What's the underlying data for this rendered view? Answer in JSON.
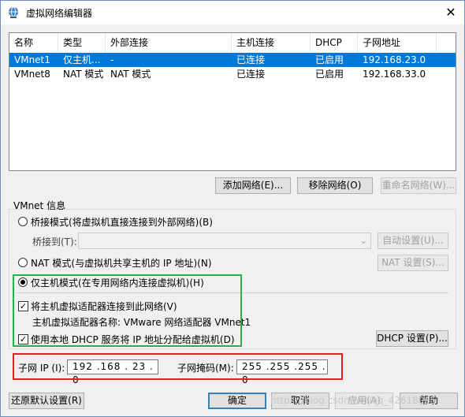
{
  "window": {
    "title": "虚拟网络编辑器",
    "close_glyph": "✕"
  },
  "table": {
    "headers": [
      "名称",
      "类型",
      "外部连接",
      "主机连接",
      "DHCP",
      "子网地址"
    ],
    "rows": [
      {
        "name": "VMnet1",
        "type": "仅主机...",
        "external": "-",
        "host": "已连接",
        "dhcp": "已启用",
        "subnet": "192.168.23.0",
        "selected": true
      },
      {
        "name": "VMnet8",
        "type": "NAT 模式",
        "external": "NAT 模式",
        "host": "已连接",
        "dhcp": "已启用",
        "subnet": "192.168.33.0",
        "selected": false
      }
    ]
  },
  "network_buttons": {
    "add": "添加网络(E)...",
    "remove": "移除网络(O)",
    "rename": "重命名网络(W)..."
  },
  "vmnet_info": {
    "label": "VMnet 信息",
    "bridged": {
      "label": "桥接模式(将虚拟机直接连接到外部网络)(B)",
      "bridge_to_label": "桥接到(T):",
      "bridge_to_value": "",
      "auto_button": "自动设置(U)..."
    },
    "nat": {
      "label": "NAT 模式(与虚拟机共享主机的 IP 地址)(N)",
      "settings_button": "NAT 设置(S)..."
    },
    "host_only": {
      "label": "仅主机模式(在专用网络内连接虚拟机)(H)",
      "selected": true
    },
    "connect_adapter": {
      "label": "将主机虚拟适配器连接到此网络(V)",
      "checked": true,
      "check_glyph": "✓"
    },
    "adapter_name": "主机虚拟适配器名称: VMware 网络适配器 VMnet1",
    "use_dhcp": {
      "label": "使用本地 DHCP 服务将 IP 地址分配给虚拟机(D)",
      "checked": true,
      "check_glyph": "✓",
      "settings_button": "DHCP 设置(P)..."
    },
    "subnet_ip": {
      "label": "子网 IP (I):",
      "value": "192 .168 . 23 . 0"
    },
    "subnet_mask": {
      "label": "子网掩码(M):",
      "value": "255 .255 .255 . 0"
    }
  },
  "footer": {
    "restore": "还原默认设置(R)",
    "ok": "确定",
    "cancel": "取消",
    "apply": "应用(A)",
    "help": "帮助"
  },
  "watermark": "https://blog.csdn.net/qq_42618065",
  "colors": {
    "selection": "#0078d7",
    "green_highlight": "#22b14c",
    "red_highlight": "#ed1c24"
  },
  "icons": {
    "app": "network-globe-icon",
    "close": "close-icon",
    "dropdown": "chevron-down-icon"
  }
}
